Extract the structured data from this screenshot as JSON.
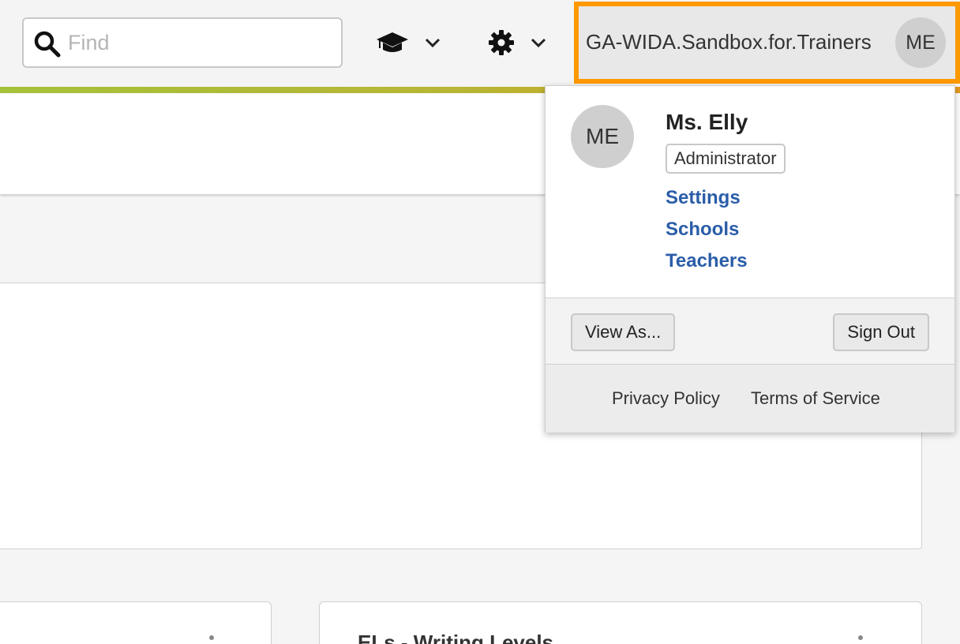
{
  "search": {
    "placeholder": "Find",
    "icon": "search-icon"
  },
  "header": {
    "menus": [
      {
        "icon": "graduation-cap-icon",
        "dropdown_icon": "chevron-down-icon"
      },
      {
        "icon": "gear-icon",
        "dropdown_icon": "chevron-down-icon"
      }
    ],
    "org_name": "GA-WIDA.Sandbox.for.Trainers",
    "avatar_initials": "ME"
  },
  "colors": {
    "accent_orange": "#ff9900",
    "link_blue": "#2a5da8"
  },
  "user_menu": {
    "avatar_initials": "ME",
    "name": "Ms. Elly",
    "role": "Administrator",
    "links": [
      "Settings",
      "Schools",
      "Teachers"
    ],
    "view_as": "View As...",
    "sign_out": "Sign Out",
    "footer": {
      "privacy": "Privacy Policy",
      "terms": "Terms of Service"
    }
  },
  "dashboard": {
    "card_right_title": "ELs - Writing Levels"
  }
}
